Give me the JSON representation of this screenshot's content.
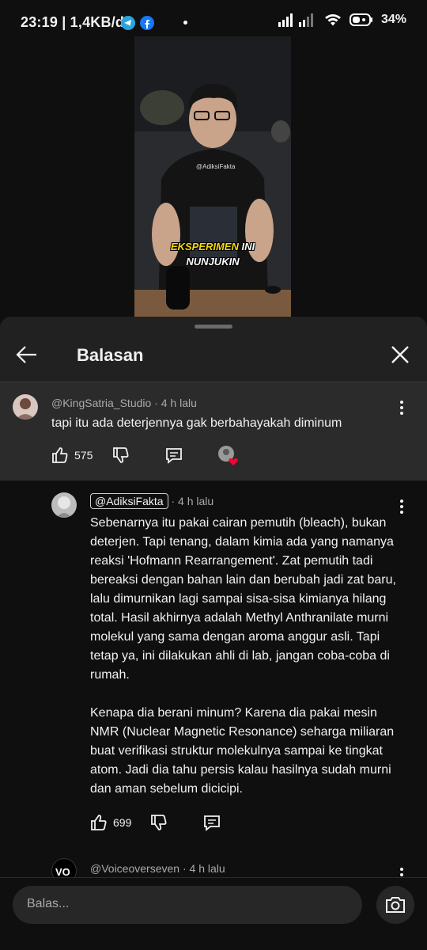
{
  "status_bar": {
    "time_speed": "23:19 | 1,4KB/d",
    "battery": "34%",
    "icons": [
      "telegram-icon",
      "facebook-icon",
      "signal-icon",
      "wifi-icon",
      "battery-icon"
    ]
  },
  "video": {
    "watermark": "@AdiksiFakta",
    "caption_line1_a": "EKSPERIMEN",
    "caption_line1_b": "INI",
    "caption_line2": "NUNJUKIN"
  },
  "sheet": {
    "title": "Balasan",
    "back_icon": "arrow-left-icon",
    "close_icon": "close-icon"
  },
  "parent_comment": {
    "author": "@KingSatria_Studio",
    "time": "4 h lalu",
    "text": "tapi itu ada deterjennya gak berbahayakah diminum",
    "likes": "575"
  },
  "reply": {
    "author": "@AdiksiFakta",
    "time": "4 h lalu",
    "paragraph1": "Sebenarnya itu pakai cairan pemutih (bleach), bukan deterjen. Tapi tenang, dalam kimia ada yang namanya reaksi 'Hofmann Rearrangement'. Zat pemutih tadi bereaksi dengan bahan lain dan berubah jadi zat baru, lalu dimurnikan lagi sampai sisa-sisa kimianya hilang total. Hasil akhirnya adalah Methyl Anthranilate murni molekul yang sama dengan aroma anggur asli. Tapi tetap ya, ini dilakukan ahli di lab, jangan coba-coba di rumah.",
    "paragraph2": "Kenapa dia berani minum? Karena dia pakai mesin NMR (Nuclear Magnetic Resonance) seharga miliaran buat verifikasi struktur molekulnya sampai ke tingkat atom. Jadi dia tahu persis kalau hasilnya sudah murni dan aman sebelum dicicipi.",
    "likes": "699"
  },
  "next_reply": {
    "author": "@Voiceoverseven",
    "time": "4 h lalu",
    "avatar_text": "VO"
  },
  "composer": {
    "placeholder": "Balas...",
    "camera_icon": "camera-icon"
  },
  "colors": {
    "background": "#0f0f0f",
    "sheet": "#212121",
    "highlighted_comment": "#2b2b2b",
    "heart": "#ff0033",
    "caption_yellow": "#f5d90a"
  }
}
